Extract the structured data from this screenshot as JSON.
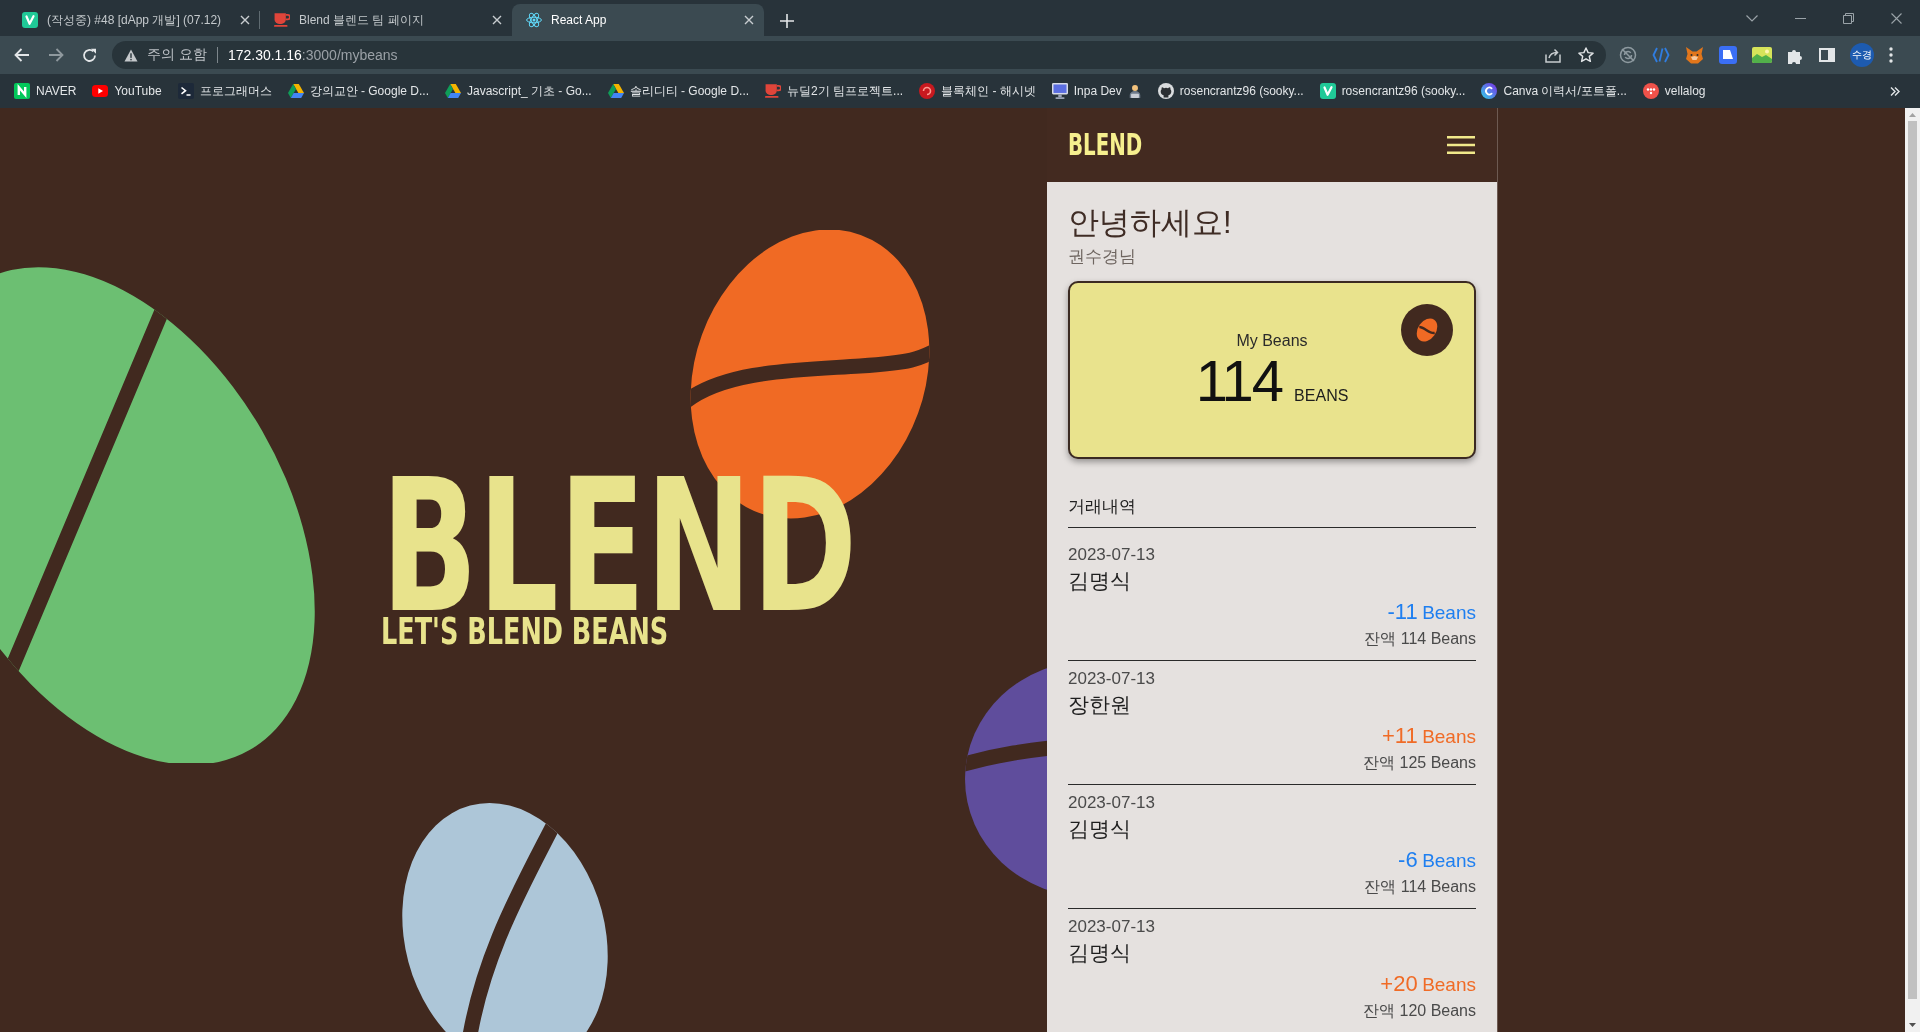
{
  "browser": {
    "tabs": [
      {
        "title": "(작성중) #48 [dApp 개발] (07.12)",
        "selected": false
      },
      {
        "title": "Blend 블렌드 팀 페이지",
        "selected": false
      },
      {
        "title": "React App",
        "selected": true
      }
    ],
    "address_bar": {
      "security_label": "주의 요함",
      "host": "172.30.1.16",
      "path": ":3000/mybeans"
    },
    "profile": {
      "initials": "수경"
    },
    "bookmarks": [
      {
        "title": "NAVER"
      },
      {
        "title": "YouTube"
      },
      {
        "title": "프로그래머스"
      },
      {
        "title": "강의교안 - Google D..."
      },
      {
        "title": "Javascript_ 기초 - Go..."
      },
      {
        "title": "솔리디티 - Google D..."
      },
      {
        "title": "뉴딜2기 팀프로젝트..."
      },
      {
        "title": "블록체인 - 해시넷"
      },
      {
        "title": "Inpa Dev"
      },
      {
        "title": "rosencrantz96 (sooky..."
      },
      {
        "title": "rosencrantz96 (sooky..."
      },
      {
        "title": "Canva 이력서/포트폴..."
      },
      {
        "title": "vellalog"
      }
    ]
  },
  "hero": {
    "title": "BLEND",
    "tagline": "LET'S BLEND BEANS"
  },
  "app": {
    "logo": "BLEND",
    "greeting": "안녕하세요!",
    "user_name": "권수경님",
    "balance_card": {
      "label": "My Beans",
      "amount": "114",
      "unit": "BEANS"
    },
    "history_title": "거래내역",
    "transactions": [
      {
        "date": "2023-07-13",
        "name": "김명식",
        "kind": "sent",
        "amount": "-11",
        "unit": "Beans",
        "balance": "잔액 114 Beans"
      },
      {
        "date": "2023-07-13",
        "name": "장한원",
        "kind": "received",
        "amount": "+11",
        "unit": "Beans",
        "balance": "잔액 125 Beans"
      },
      {
        "date": "2023-07-13",
        "name": "김명식",
        "kind": "sent",
        "amount": "-6",
        "unit": "Beans",
        "balance": "잔액 114 Beans"
      },
      {
        "date": "2023-07-13",
        "name": "김명식",
        "kind": "received",
        "amount": "+20",
        "unit": "Beans",
        "balance": "잔액 120 Beans"
      }
    ]
  }
}
